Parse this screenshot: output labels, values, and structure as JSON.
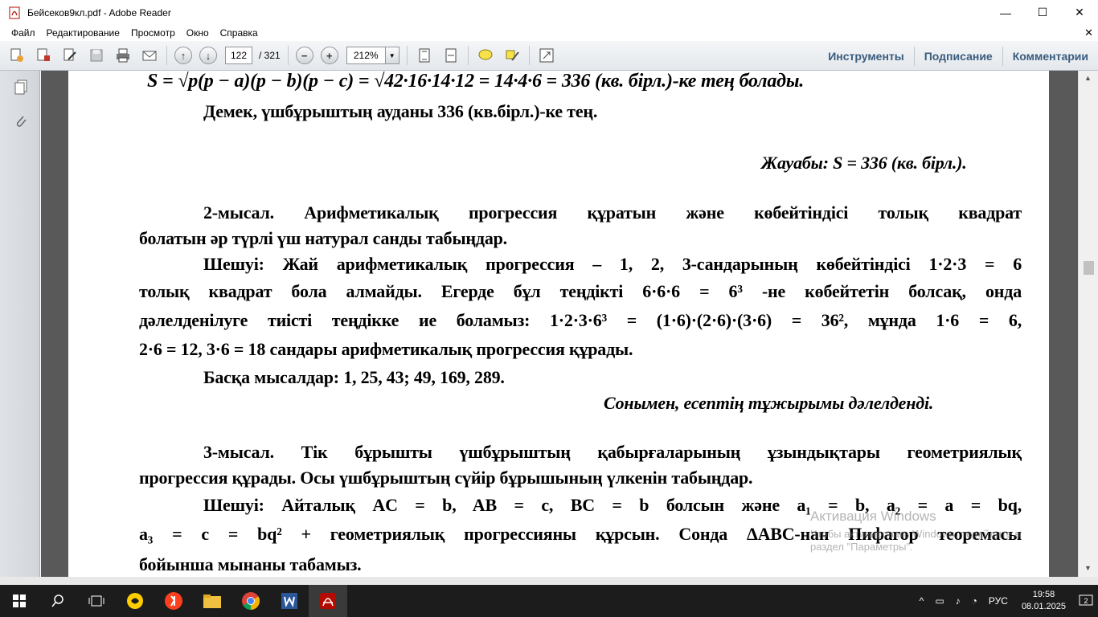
{
  "window": {
    "title": "Бейсеков9кл.pdf - Adobe Reader",
    "minimize": "—",
    "maximize": "☐",
    "close": "✕"
  },
  "menu": {
    "items": [
      "Файл",
      "Редактирование",
      "Просмотр",
      "Окно",
      "Справка"
    ],
    "close": "✕"
  },
  "toolbar": {
    "page_current": "122",
    "page_total": "/ 321",
    "zoom": "212%",
    "links": [
      "Инструменты",
      "Подписание",
      "Комментарии"
    ]
  },
  "document": {
    "lines": [
      "S = √p(p − a)(p − b)(p − c) = √42·16·14·12 = 14·4·6 = 336 (кв. бірл.)-ке тең болады.",
      "Демек, үшбұрыштың ауданы 336 (кв.бірл.)-ке тең.",
      "Жауабы: S = 336 (кв. бірл.).",
      "2-мысал. Арифметикалық прогрессия құратын және көбейтіндісі толық квадрат",
      "болатын әр түрлі үш натурал санды табыңдар.",
      "Шешуі: Жай арифметикалық прогрессия – 1, 2, 3-сандарының көбейтіндісі 1·2·3 = 6",
      "толық квадрат бола алмайды. Егерде бұл теңдікті 6·6·6 = 6³ -не көбейтетін болсақ, онда",
      "дәлелденілуге тиісті теңдікке ие боламыз: 1·2·3·6³ = (1·6)·(2·6)·(3·6) = 36², мұнда 1·6 = 6,",
      "2·6 = 12, 3·6 = 18 сандары арифметикалық прогрессия құрады.",
      "Басқа мысалдар: 1, 25, 43; 49, 169, 289.",
      "Сонымен, есептің тұжырымы дәлелденді.",
      "3-мысал. Тік бұрышты үшбұрыштың қабырғаларының ұзындықтары геометриялық",
      "прогрессия құрады. Осы үшбұрыштың сүйір бұрышының үлкенін табыңдар.",
      "Шешуі: Айталық AC = b, AB = c, BC = b болсын және a₁ = b, a₂ = a = bq,",
      "a₃ = c = bq² + геометриялық прогрессияны құрсын. Сонда ΔABC-нан Пифагор теоремасы",
      "бойынша мынаны табамыз."
    ]
  },
  "watermark": {
    "line1": "Активация Windows",
    "line2": "Чтобы активировать Windows, перейдите в",
    "line3": "раздел \"Параметры\"."
  },
  "taskbar": {
    "lang": "РУС",
    "time": "19:58",
    "date": "08.01.2025",
    "notifications": "2"
  }
}
